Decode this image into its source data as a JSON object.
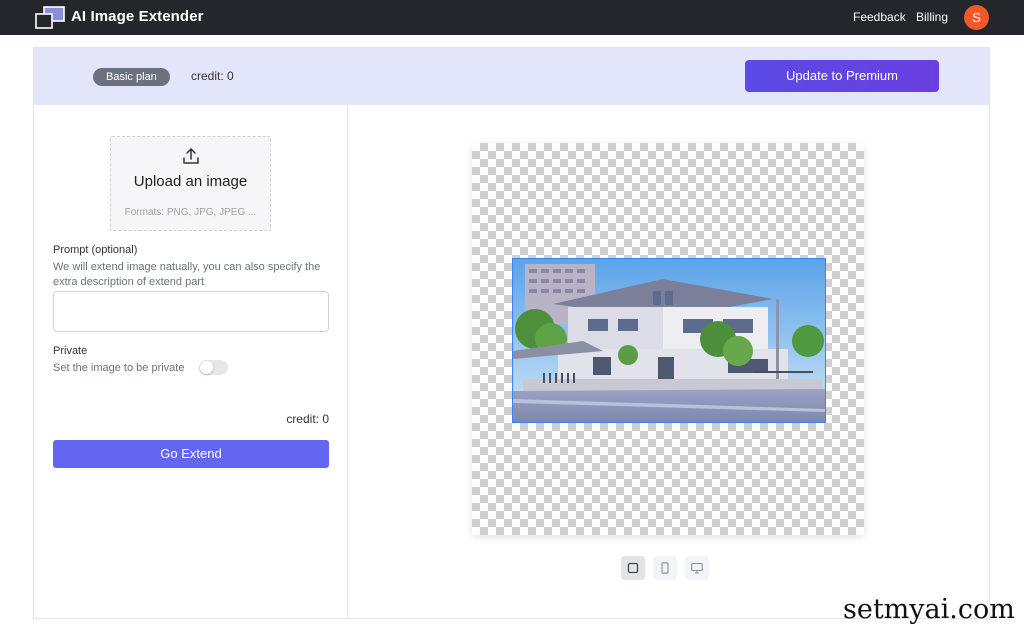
{
  "header": {
    "app_title": "AI Image Extender",
    "nav": {
      "feedback": "Feedback",
      "billing": "Billing"
    },
    "avatar_initial": "S",
    "colors": {
      "background": "#24262b",
      "avatar": "#f05a28"
    },
    "logo_icon": "layered-squares-logo"
  },
  "plan_bar": {
    "plan_badge": "Basic plan",
    "credit_text": "credit: 0",
    "upgrade_button": "Update to Premium",
    "colors": {
      "background": "#e3e5fb",
      "button": "#5b4be6"
    }
  },
  "left_panel": {
    "upload": {
      "icon": "upload-icon",
      "title": "Upload an image",
      "formats": "Formats: PNG, JPG, JPEG ..."
    },
    "prompt": {
      "label": "Prompt (optional)",
      "help": "We will extend image natually, you can also specify the extra description of extend part",
      "value": ""
    },
    "private": {
      "label": "Private",
      "help": "Set the image to be private",
      "enabled": false
    },
    "credit_text": "credit: 0",
    "go_button": "Go Extend",
    "colors": {
      "go_button": "#6366f1"
    }
  },
  "preview": {
    "canvas_background": "transparency-checkerboard",
    "image_content": "two-story house with street view",
    "selection_border_color": "#3b82f6",
    "view_modes": [
      {
        "icon": "square-icon",
        "selected": true
      },
      {
        "icon": "portrait-icon",
        "selected": false
      },
      {
        "icon": "monitor-icon",
        "selected": false
      }
    ]
  },
  "watermark": "setmyai.com"
}
